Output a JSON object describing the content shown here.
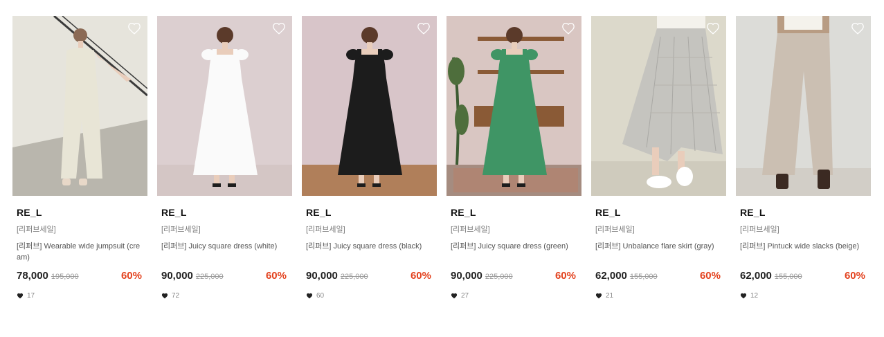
{
  "products": [
    {
      "brand": "RE_L",
      "tag": "[리퍼브세일]",
      "name": "[리퍼브] Wearable wide jumpsuit (cream)",
      "price": "78,000",
      "original_price": "195,000",
      "discount": "60%",
      "likes": "17",
      "image": {
        "bg": "#e6e4dc",
        "floor": "#b9b6ad",
        "garment": "#e8e5d6",
        "accent": "#3a3a3a",
        "type": "jumpsuit"
      }
    },
    {
      "brand": "RE_L",
      "tag": "[리퍼브세일]",
      "name": "[리퍼브] Juicy square dress (white)",
      "price": "90,000",
      "original_price": "225,000",
      "discount": "60%",
      "likes": "72",
      "image": {
        "bg": "#dccfd0",
        "floor": "#d4c6c5",
        "garment": "#fafafa",
        "accent": "#d8c3b8",
        "type": "dress"
      }
    },
    {
      "brand": "RE_L",
      "tag": "[리퍼브세일]",
      "name": "[리퍼브] Juicy square dress (black)",
      "price": "90,000",
      "original_price": "225,000",
      "discount": "60%",
      "likes": "60",
      "image": {
        "bg": "#d8c5c9",
        "floor": "#b07f5a",
        "garment": "#1c1c1c",
        "accent": "#d9b9a8",
        "type": "dress"
      }
    },
    {
      "brand": "RE_L",
      "tag": "[리퍼브세일]",
      "name": "[리퍼브] Juicy square dress (green)",
      "price": "90,000",
      "original_price": "225,000",
      "discount": "60%",
      "likes": "27",
      "image": {
        "bg": "#d9c6c2",
        "floor": "#a58c80",
        "garment": "#3f9565",
        "accent": "#8a5a36",
        "type": "dress-room"
      }
    },
    {
      "brand": "RE_L",
      "tag": "[리퍼브세일]",
      "name": "[리퍼브] Unbalance flare skirt (gray)",
      "price": "62,000",
      "original_price": "155,000",
      "discount": "60%",
      "likes": "21",
      "image": {
        "bg": "#dcd9cb",
        "floor": "#cfcbbd",
        "garment": "#c5c4bf",
        "accent": "#ffffff",
        "type": "skirt"
      }
    },
    {
      "brand": "RE_L",
      "tag": "[리퍼브세일]",
      "name": "[리퍼브] Pintuck wide slacks (beige)",
      "price": "62,000",
      "original_price": "155,000",
      "discount": "60%",
      "likes": "12",
      "image": {
        "bg": "#dcdcd8",
        "floor": "#d2cec7",
        "garment": "#cbbfb2",
        "accent": "#3b2a22",
        "type": "slacks"
      }
    }
  ],
  "icons": {
    "wishlist": "heart-outline-icon",
    "likes": "heart-filled-icon"
  },
  "colors": {
    "discount": "#e3421e",
    "price": "#222222",
    "original_price": "#999999"
  }
}
